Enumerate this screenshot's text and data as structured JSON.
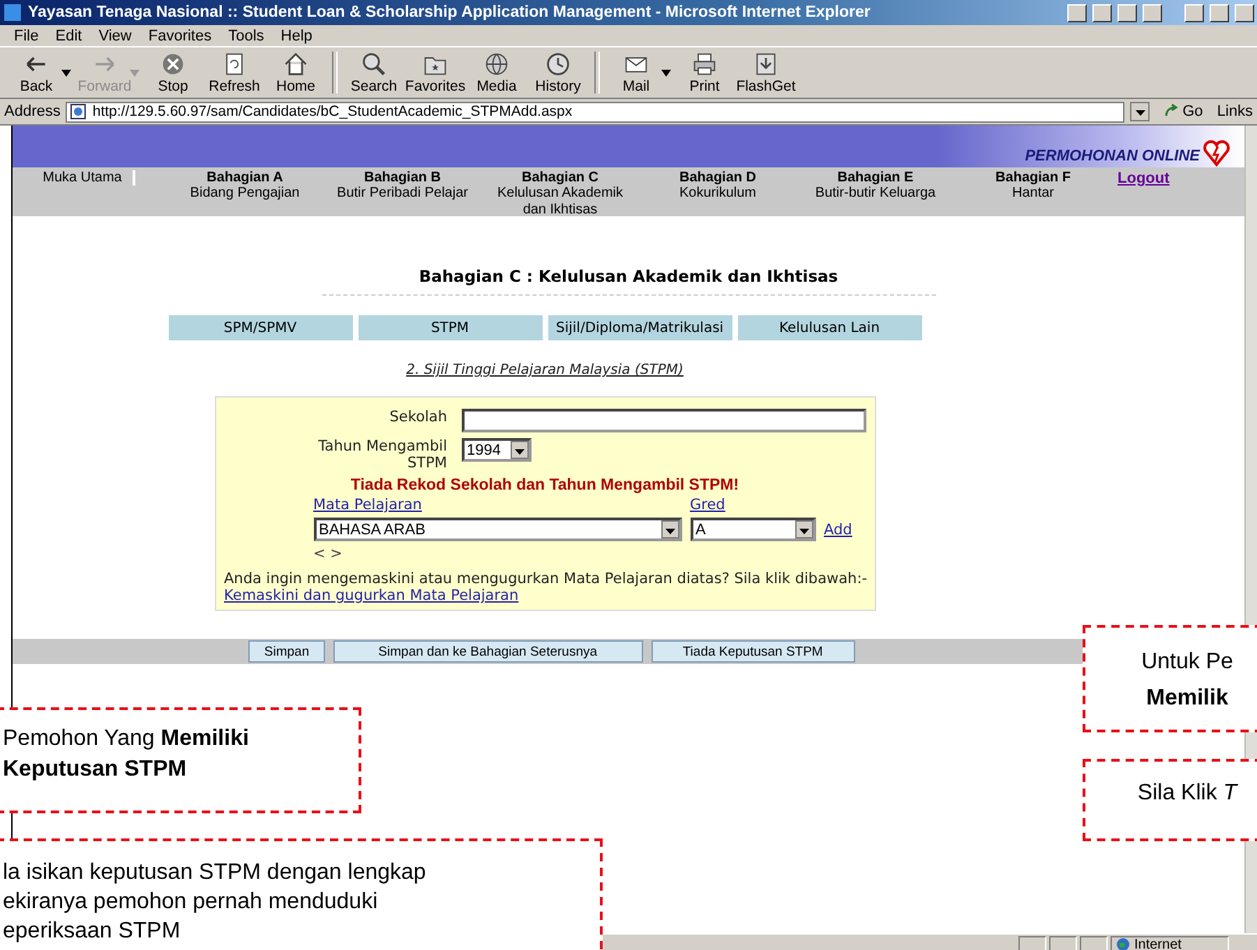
{
  "window": {
    "title": "Yayasan Tenaga Nasional :: Student Loan & Scholarship Application Management - Microsoft Internet Explorer"
  },
  "menu": [
    "File",
    "Edit",
    "View",
    "Favorites",
    "Tools",
    "Help"
  ],
  "toolbar": [
    {
      "label": "Back",
      "disabled": false
    },
    {
      "label": "Forward",
      "disabled": true
    },
    {
      "label": "Stop",
      "disabled": false
    },
    {
      "label": "Refresh",
      "disabled": false
    },
    {
      "label": "Home",
      "disabled": false
    },
    {
      "label": "Search",
      "disabled": false
    },
    {
      "label": "Favorites",
      "disabled": false
    },
    {
      "label": "Media",
      "disabled": false
    },
    {
      "label": "History",
      "disabled": false
    },
    {
      "label": "Mail",
      "disabled": false
    },
    {
      "label": "Print",
      "disabled": false
    },
    {
      "label": "FlashGet",
      "disabled": false
    }
  ],
  "address": {
    "label": "Address",
    "value": "http://129.5.60.97/sam/Candidates/bC_StudentAcademic_STPMAdd.aspx",
    "go": "Go",
    "links": "Links"
  },
  "banner": {
    "title": "PERMOHONAN ONLINE"
  },
  "nav": [
    {
      "kind": "home",
      "title": "Muka Utama"
    },
    {
      "kind": "section",
      "title": "Bahagian A",
      "subtitle": "Bidang Pengajian"
    },
    {
      "kind": "section",
      "title": "Bahagian B",
      "subtitle": "Butir Peribadi Pelajar"
    },
    {
      "kind": "section",
      "title": "Bahagian C",
      "subtitle": "Kelulusan Akademik\ndan Ikhtisas"
    },
    {
      "kind": "section",
      "title": "Bahagian D",
      "subtitle": "Kokurikulum"
    },
    {
      "kind": "section",
      "title": "Bahagian E",
      "subtitle": "Butir-butir Keluarga"
    },
    {
      "kind": "section",
      "title": "Bahagian F",
      "subtitle": "Hantar"
    },
    {
      "kind": "link",
      "title": "Logout"
    }
  ],
  "heading": "Bahagian C : Kelulusan Akademik dan Ikhtisas",
  "tabs": [
    "SPM/SPMV",
    "STPM",
    "Sijil/Diploma/Matrikulasi",
    "Kelulusan Lain"
  ],
  "subtitle": "2. Sijil Tinggi Pelajaran Malaysia (STPM)",
  "form": {
    "school_label": "Sekolah",
    "year_label": "Tahun Mengambil\nSTPM",
    "year": "1994",
    "error": "Tiada Rekod Sekolah dan Tahun Mengambil STPM!",
    "subject_header": "Mata Pelajaran",
    "grade_header": "Gred",
    "subject": "BAHASA ARAB",
    "grade": "A",
    "add": "Add",
    "pager": "< >",
    "note": "Anda ingin mengemaskini atau mengugurkan Mata Pelajaran diatas? Sila klik dibawah:-",
    "update_link": "Kemaskini dan gugurkan Mata Pelajaran"
  },
  "buttons": [
    "Simpan",
    "Simpan dan ke Bahagian Seterusnya",
    "Tiada Keputusan STPM"
  ],
  "status_bar": {
    "zone": "Internet"
  },
  "callouts": [
    {
      "lines": [
        "Pemohon Yang **Memiliki**",
        "**Keputusan STPM**"
      ]
    },
    {
      "lines": [
        "la isikan keputusan STPM dengan lengkap",
        "ekiranya pemohon pernah menduduki",
        "eperiksaan STPM"
      ]
    },
    {
      "lines": [
        "Untuk Pe",
        "**Memilik**"
      ]
    },
    {
      "lines": [
        "Sila Klik *T*"
      ]
    }
  ]
}
